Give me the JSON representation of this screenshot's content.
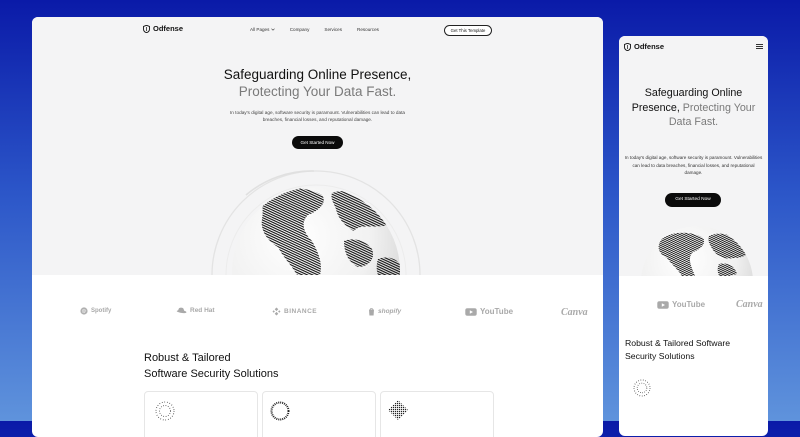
{
  "desktop": {
    "brand": "Odfense",
    "nav": [
      "All Pages",
      "Company",
      "Services",
      "Resources"
    ],
    "cta": "Get This Template",
    "headline_1": "Safeguarding Online Presence,",
    "headline_2": "Protecting Your Data Fast.",
    "paragraph": "In today's digital age, software security is paramount. Vulnerabilities can lead to data breaches, financial losses, and reputational damage.",
    "button": "Get Started Now",
    "logos": [
      "Spotify",
      "Red Hat",
      "BINANCE",
      "shopify",
      "YouTube",
      "Canva"
    ],
    "section_title_1": "Robust & Tailored",
    "section_title_2": "Software Security Solutions"
  },
  "mobile": {
    "brand": "Odfense",
    "headline_1": "Safeguarding Online",
    "headline_2": "Presence,",
    "headline_3": "Protecting Your",
    "headline_4": "Data Fast.",
    "paragraph": "In today's digital age, software security is paramount. Vulnerabilities can lead to data breaches, financial losses, and reputational damage.",
    "button": "Get Started Now",
    "logos": [
      "YouTube",
      "Canva"
    ],
    "section_title_1": "Robust & Tailored Software",
    "section_title_2": "Security Solutions"
  },
  "icons": {
    "brand_logo": "shield-logo-icon",
    "nav_dropdown": "chevron-down-icon",
    "mobile_menu": "hamburger-menu-icon",
    "globe": "dotted-globe-icon",
    "card_icons": [
      "dotted-circle-icon",
      "dashed-ring-icon",
      "dotted-diamond-icon"
    ]
  },
  "colors": {
    "background_gradient": [
      "#0a1aa8",
      "#5f93dc"
    ],
    "hero_bg": "#f4f4f5",
    "primary_button": "#0b0b0b",
    "headline_accent": "#7a7a7a"
  }
}
